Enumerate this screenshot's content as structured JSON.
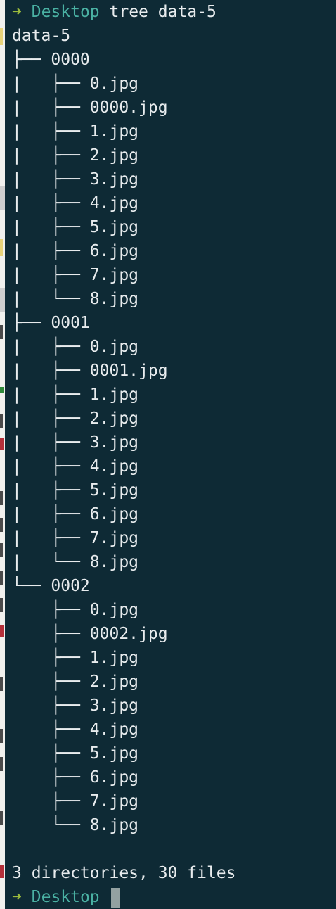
{
  "prompt": {
    "arrow": "➜",
    "cwd": "Desktop",
    "command": "tree data-5"
  },
  "output": [
    "data-5",
    "├── 0000",
    "|   ├── 0.jpg",
    "|   ├── 0000.jpg",
    "|   ├── 1.jpg",
    "|   ├── 2.jpg",
    "|   ├── 3.jpg",
    "|   ├── 4.jpg",
    "|   ├── 5.jpg",
    "|   ├── 6.jpg",
    "|   ├── 7.jpg",
    "|   └── 8.jpg",
    "├── 0001",
    "|   ├── 0.jpg",
    "|   ├── 0001.jpg",
    "|   ├── 1.jpg",
    "|   ├── 2.jpg",
    "|   ├── 3.jpg",
    "|   ├── 4.jpg",
    "|   ├── 5.jpg",
    "|   ├── 6.jpg",
    "|   ├── 7.jpg",
    "|   └── 8.jpg",
    "└── 0002",
    "    ├── 0.jpg",
    "    ├── 0002.jpg",
    "    ├── 1.jpg",
    "    ├── 2.jpg",
    "    ├── 3.jpg",
    "    ├── 4.jpg",
    "    ├── 5.jpg",
    "    ├── 6.jpg",
    "    ├── 7.jpg",
    "    └── 8.jpg",
    "",
    "3 directories, 30 files"
  ],
  "final_prompt": {
    "arrow": "➜",
    "cwd": "Desktop"
  },
  "colors": {
    "background": "#0e2a35",
    "arrow": "#9bbb3d",
    "cwd": "#4ab1a3",
    "text": "#e8ecee",
    "cursor": "#93a1a1"
  }
}
